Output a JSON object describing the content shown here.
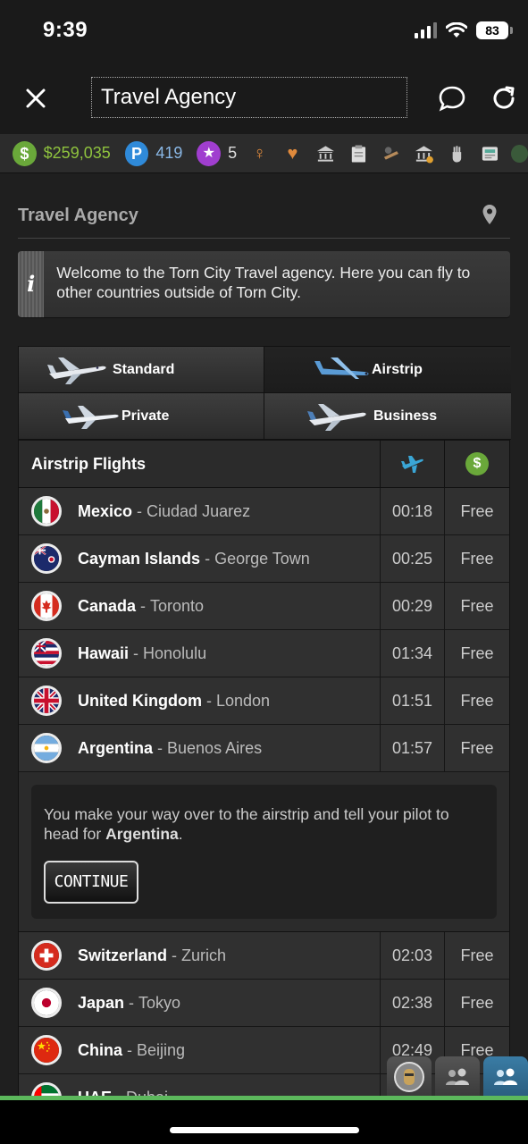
{
  "status_bar": {
    "time": "9:39",
    "battery": "83"
  },
  "nav": {
    "title": "Travel Agency"
  },
  "user_info": {
    "money": "$259,035",
    "points": "419",
    "merits": "5"
  },
  "page": {
    "title": "Travel Agency",
    "info_message": "Welcome to the Torn City Travel agency. Here you can fly to other countries outside of Torn City."
  },
  "tabs": [
    {
      "label": "Standard",
      "active": false
    },
    {
      "label": "Airstrip",
      "active": true
    },
    {
      "label": "Private",
      "active": false
    },
    {
      "label": "Business",
      "active": false
    }
  ],
  "flights_header": {
    "title": "Airstrip Flights"
  },
  "flights": [
    {
      "country": "Mexico",
      "city": "Ciudad Juarez",
      "time": "00:18",
      "cost": "Free",
      "flag": "mexico"
    },
    {
      "country": "Cayman Islands",
      "city": "George Town",
      "time": "00:25",
      "cost": "Free",
      "flag": "cayman-islands"
    },
    {
      "country": "Canada",
      "city": "Toronto",
      "time": "00:29",
      "cost": "Free",
      "flag": "canada"
    },
    {
      "country": "Hawaii",
      "city": "Honolulu",
      "time": "01:34",
      "cost": "Free",
      "flag": "hawaii"
    },
    {
      "country": "United Kingdom",
      "city": "London",
      "time": "01:51",
      "cost": "Free",
      "flag": "united-kingdom"
    },
    {
      "country": "Argentina",
      "city": "Buenos Aires",
      "time": "01:57",
      "cost": "Free",
      "flag": "argentina"
    }
  ],
  "confirm": {
    "message_prefix": "You make your way over to the airstrip and tell your pilot to head for ",
    "destination": "Argentina",
    "message_suffix": ".",
    "button_label": "CONTINUE"
  },
  "flights_after": [
    {
      "country": "Switzerland",
      "city": "Zurich",
      "time": "02:03",
      "cost": "Free",
      "flag": "switzerland"
    },
    {
      "country": "Japan",
      "city": "Tokyo",
      "time": "02:38",
      "cost": "Free",
      "flag": "japan"
    },
    {
      "country": "China",
      "city": "Beijing",
      "time": "02:49",
      "cost": "Free",
      "flag": "china"
    },
    {
      "country": "UAE",
      "city": "Dubai",
      "time": "",
      "cost": "",
      "flag": "uae"
    }
  ],
  "separator": "-",
  "colors": {
    "money": "#8fc33e",
    "points_badge": "#2f8ad9",
    "merits_badge": "#a03ecf",
    "accent_green": "#5cb85c"
  }
}
